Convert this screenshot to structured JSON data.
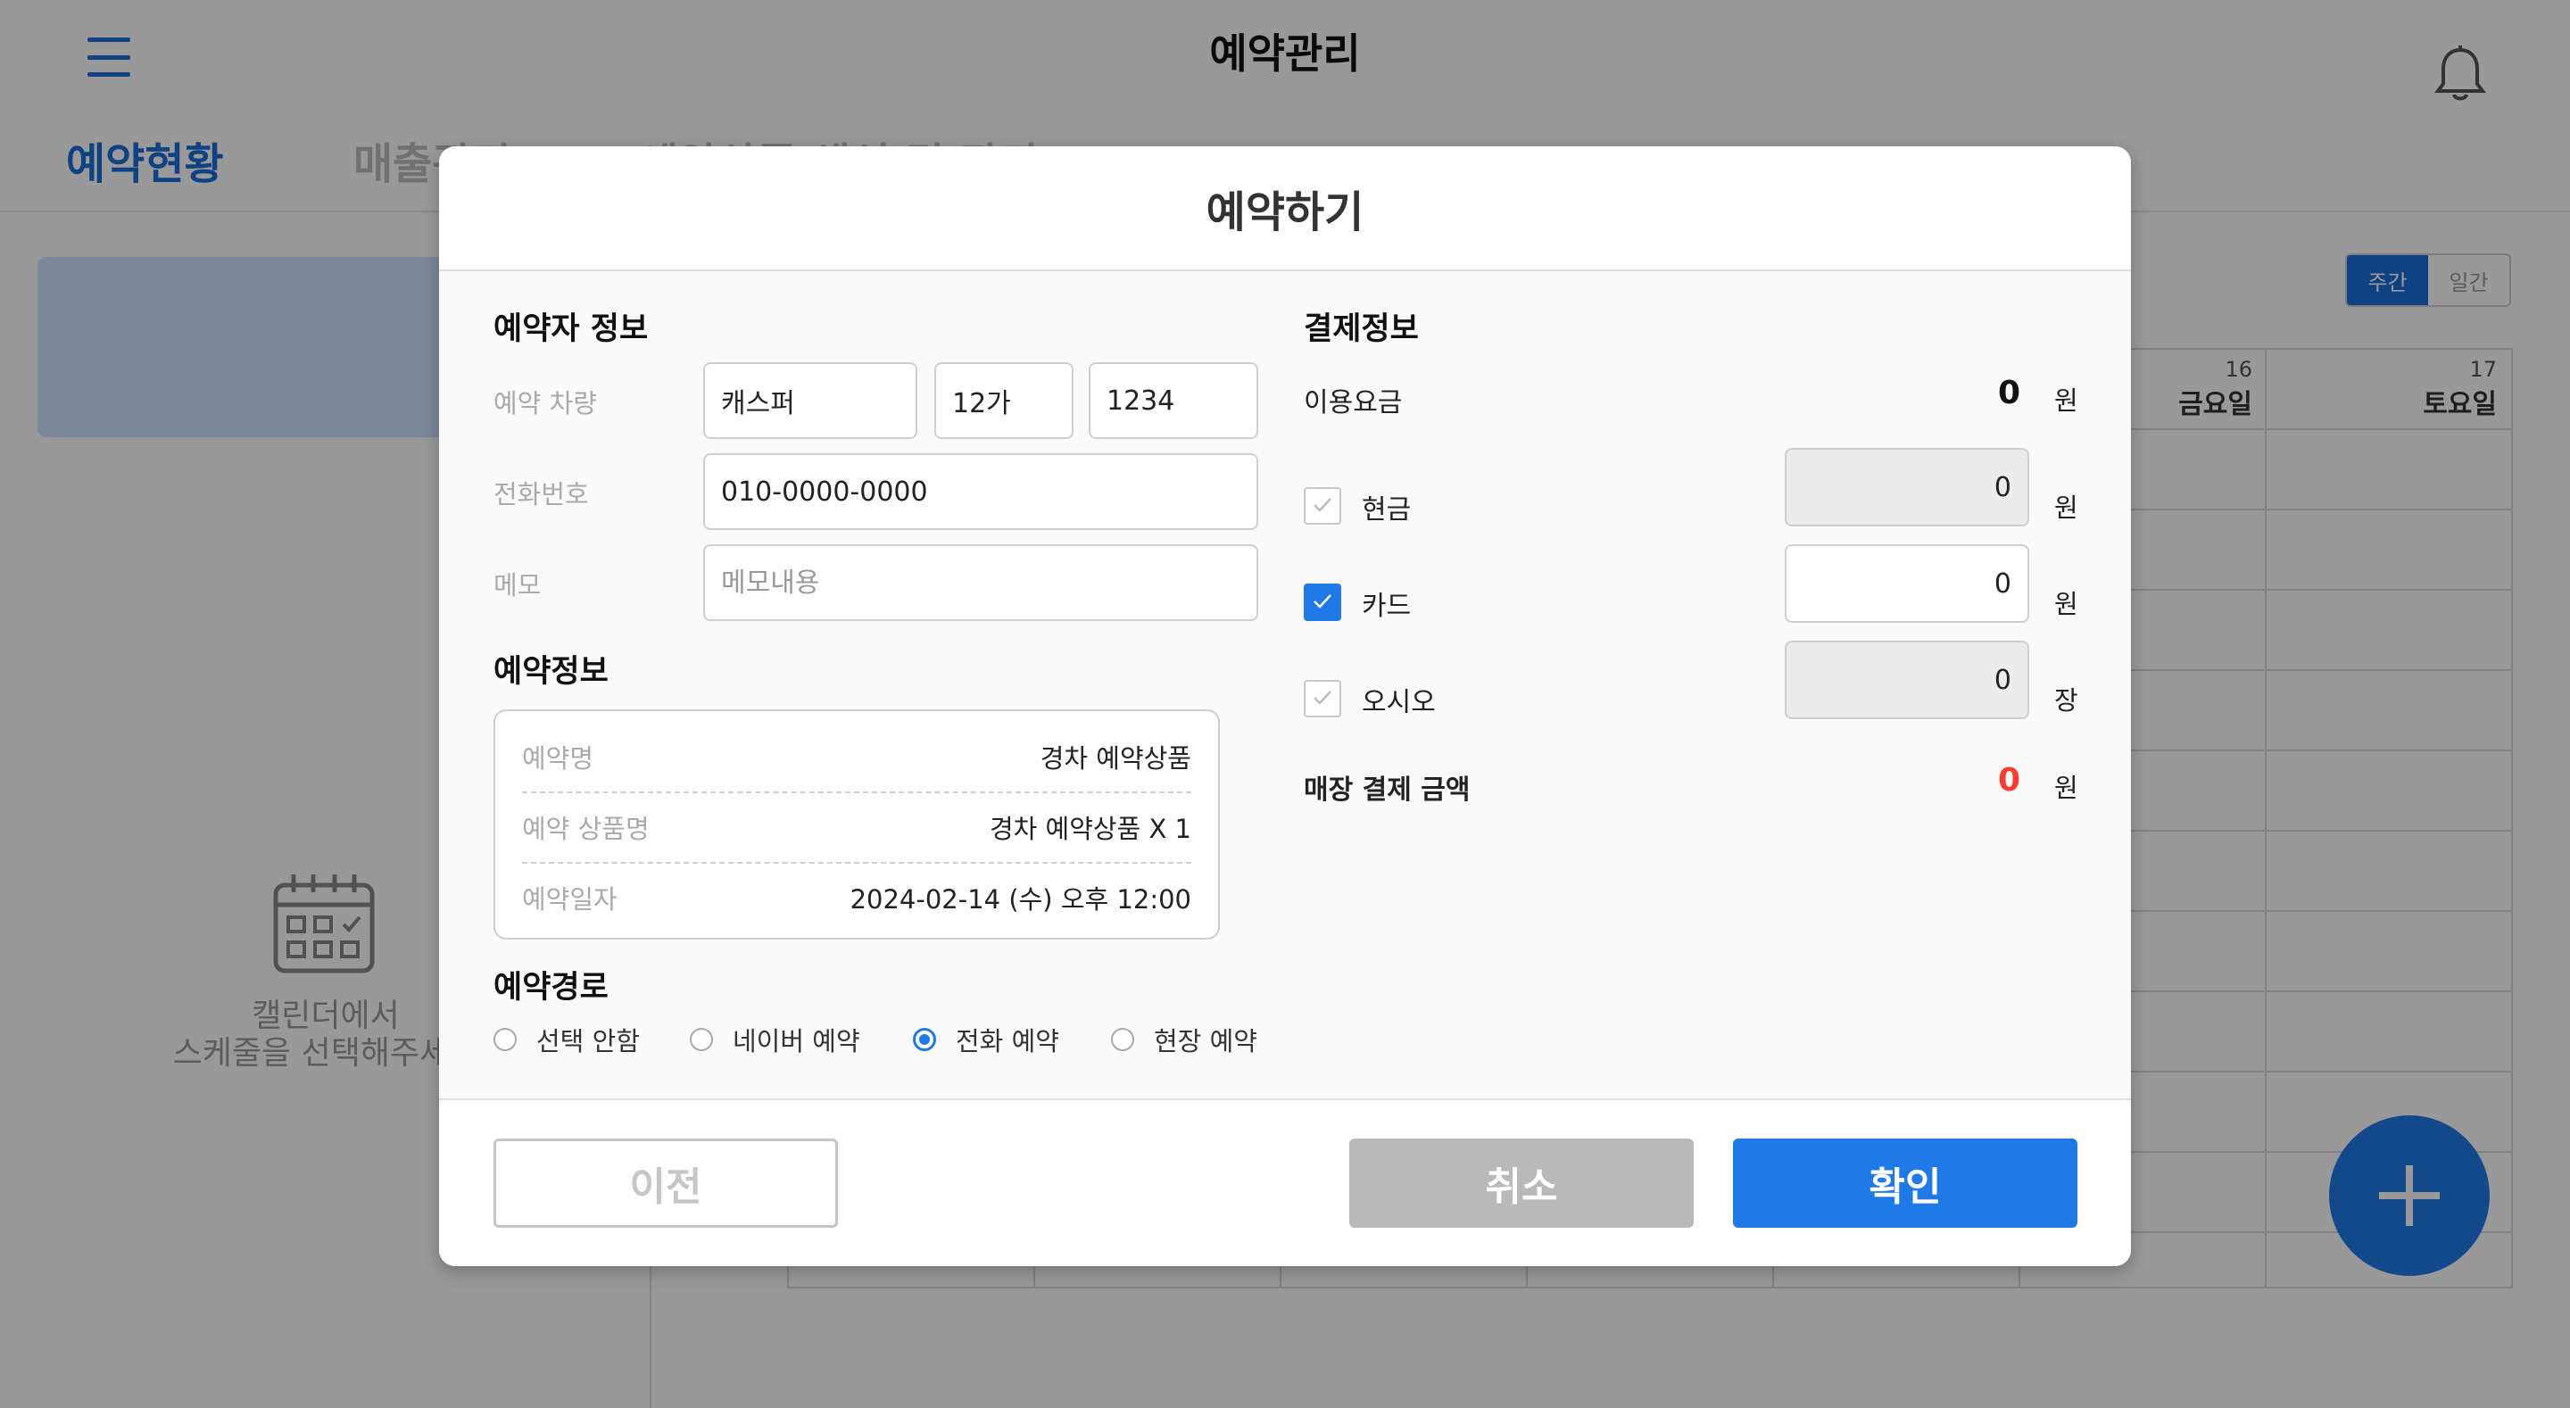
{
  "header": {
    "title": "예약관리"
  },
  "tabs": [
    {
      "label": "예약현황",
      "active": true
    },
    {
      "label": "매출관리",
      "active": false
    },
    {
      "label": "예약상품 생성 및 관리",
      "active": false
    }
  ],
  "left_panel": {
    "empty_line1": "캘린더에서",
    "empty_line2": "스케줄을 선택해주세요"
  },
  "calendar": {
    "view_toggle": [
      {
        "label": "주간",
        "active": true
      },
      {
        "label": "일간",
        "active": false
      }
    ],
    "days": [
      {
        "date": "16",
        "weekday": "금요일"
      },
      {
        "date": "17",
        "weekday": "토요일"
      }
    ]
  },
  "modal": {
    "title": "예약하기",
    "reserver": {
      "section_title": "예약자 정보",
      "vehicle_label": "예약 차량",
      "vehicle_model": "캐스퍼",
      "vehicle_plate_prefix": "12가",
      "vehicle_plate_number": "1234",
      "phone_label": "전화번호",
      "phone_value": "010-0000-0000",
      "memo_label": "메모",
      "memo_placeholder": "메모내용"
    },
    "reservation": {
      "section_title": "예약정보",
      "rows": [
        {
          "key": "예약명",
          "value": "경차 예약상품"
        },
        {
          "key": "예약 상품명",
          "value": "경차 예약상품 X 1"
        },
        {
          "key": "예약일자",
          "value": "2024-02-14 (수) 오후 12:00"
        }
      ]
    },
    "route": {
      "section_title": "예약경로",
      "options": [
        {
          "label": "선택 안함",
          "selected": false
        },
        {
          "label": "네이버 예약",
          "selected": false
        },
        {
          "label": "전화 예약",
          "selected": true
        },
        {
          "label": "현장 예약",
          "selected": false
        }
      ]
    },
    "payment": {
      "section_title": "결제정보",
      "fee_label": "이용요금",
      "fee_value": "0",
      "fee_unit": "원",
      "methods": [
        {
          "label": "현금",
          "checked": false,
          "amount": "0",
          "unit": "원",
          "disabled": true
        },
        {
          "label": "카드",
          "checked": true,
          "amount": "0",
          "unit": "원",
          "disabled": false
        },
        {
          "label": "오시오",
          "checked": false,
          "amount": "0",
          "unit": "장",
          "disabled": true
        }
      ],
      "store_total_label": "매장 결제 금액",
      "store_total_value": "0",
      "store_total_unit": "원",
      "store_total_color": "#ff3b30"
    },
    "buttons": {
      "prev": "이전",
      "cancel": "취소",
      "confirm": "확인"
    }
  },
  "colors": {
    "accent": "#1f7ae8",
    "tab_active": "#1a6fd9"
  }
}
